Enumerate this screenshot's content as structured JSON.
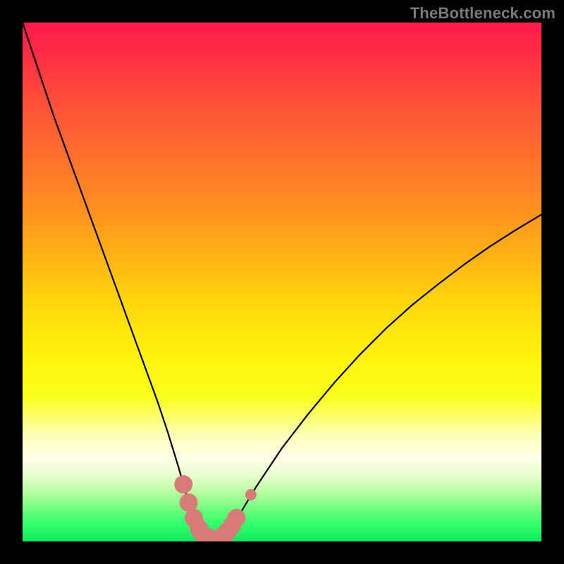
{
  "watermark": "TheBottleneck.com",
  "colors": {
    "frame": "#000000",
    "curve": "#000000",
    "marker_fill": "#d77a78",
    "marker_stroke": "#c96360"
  },
  "chart_data": {
    "type": "line",
    "title": "",
    "xlabel": "",
    "ylabel": "",
    "xlim": [
      0,
      100
    ],
    "ylim": [
      0,
      100
    ],
    "grid": false,
    "legend": false,
    "series": [
      {
        "name": "bottleneck-curve",
        "x": [
          0,
          2,
          4,
          6,
          8,
          10,
          12,
          14,
          16,
          18,
          20,
          22,
          24,
          26,
          28,
          30,
          31,
          32,
          33,
          34,
          35,
          36,
          37,
          38,
          39,
          40,
          42,
          45,
          50,
          55,
          60,
          65,
          70,
          75,
          80,
          85,
          90,
          95,
          100
        ],
        "y": [
          100,
          94,
          88,
          82,
          76.5,
          71,
          65.5,
          60,
          54.5,
          49,
          43.5,
          38,
          32.5,
          27,
          21,
          14.5,
          11,
          7.5,
          4.5,
          2.5,
          1.3,
          0.6,
          0.4,
          0.6,
          1.2,
          2.4,
          5.5,
          10.5,
          18,
          24.5,
          30.5,
          36,
          41,
          45.5,
          49.5,
          53.3,
          56.8,
          60,
          63
        ]
      }
    ],
    "markers": [
      {
        "x": 31.0,
        "y": 11.0,
        "size": 13
      },
      {
        "x": 32.0,
        "y": 7.5,
        "size": 13
      },
      {
        "x": 33.0,
        "y": 4.5,
        "size": 13
      },
      {
        "x": 34.0,
        "y": 2.5,
        "size": 13
      },
      {
        "x": 34.6,
        "y": 1.5,
        "size": 13
      },
      {
        "x": 35.3,
        "y": 0.9,
        "size": 13
      },
      {
        "x": 36.0,
        "y": 0.6,
        "size": 13
      },
      {
        "x": 36.7,
        "y": 0.5,
        "size": 13
      },
      {
        "x": 37.4,
        "y": 0.5,
        "size": 13
      },
      {
        "x": 38.1,
        "y": 0.7,
        "size": 13
      },
      {
        "x": 38.8,
        "y": 1.2,
        "size": 13
      },
      {
        "x": 39.5,
        "y": 1.9,
        "size": 13
      },
      {
        "x": 40.3,
        "y": 3.0,
        "size": 13
      },
      {
        "x": 41.2,
        "y": 4.5,
        "size": 13
      },
      {
        "x": 44.0,
        "y": 9.0,
        "size": 8
      }
    ]
  }
}
